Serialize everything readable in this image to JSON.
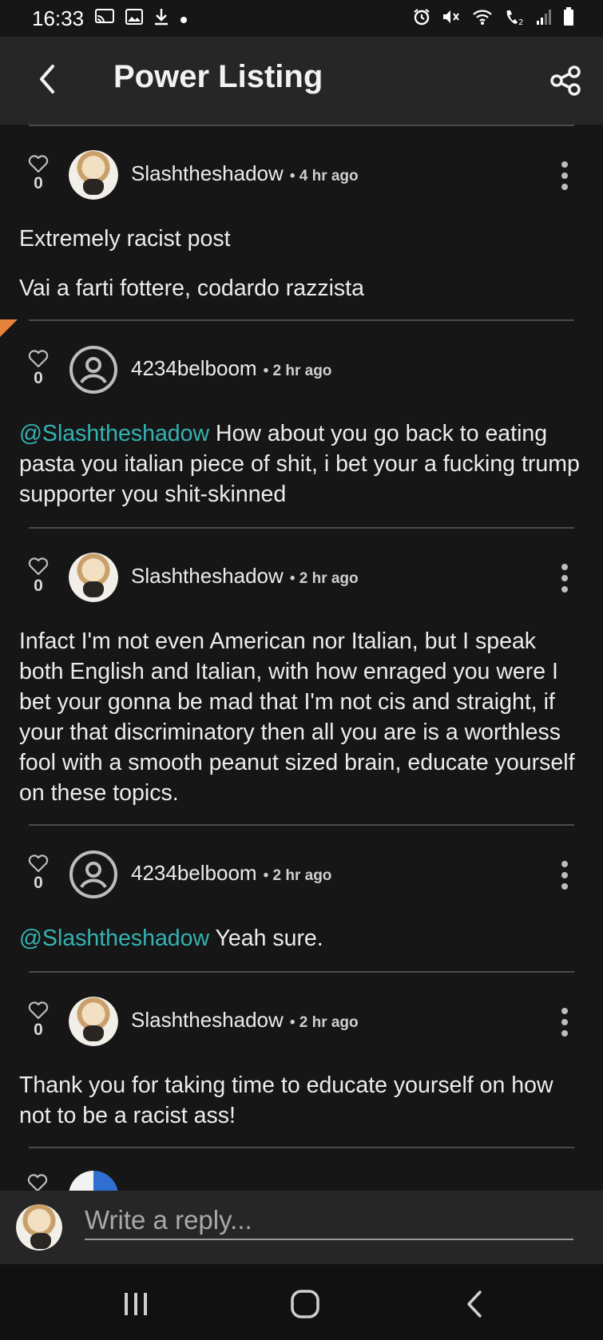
{
  "status_bar": {
    "time": "16:33",
    "left_icons": [
      "cast-icon",
      "image-icon",
      "download-icon",
      "dot-icon"
    ],
    "right_icons": [
      "alarm-icon",
      "mute-icon",
      "wifi-icon",
      "wifi-call-icon",
      "signal-icon",
      "battery-icon"
    ]
  },
  "app_bar": {
    "title": "Power Listing"
  },
  "comments": [
    {
      "likes": "0",
      "author": "Slashtheshadow",
      "time": "• 4 hr ago",
      "avatar": "user-photo",
      "paragraphs": [
        {
          "mention": "",
          "text": "Extremely racist post"
        },
        {
          "mention": "",
          "text": "Vai a farti fottere, codardo razzista"
        }
      ]
    },
    {
      "likes": "0",
      "author": "4234belboom",
      "time": "• 2 hr ago",
      "avatar": "default-user-icon",
      "paragraphs": [
        {
          "mention": "@Slashtheshadow",
          "text": " How about you go back to eating pasta you italian piece of shit, i bet your a fucking trump supporter you shit-skinned"
        }
      ]
    },
    {
      "likes": "0",
      "author": "Slashtheshadow",
      "time": "• 2 hr ago",
      "avatar": "user-photo",
      "paragraphs": [
        {
          "mention": "",
          "text": "Infact I'm not even American nor Italian, but I speak both English and Italian, with how enraged you were I bet your gonna be mad that I'm not cis and straight, if your that discriminatory then all you are is a worthless fool with a smooth peanut sized brain, educate yourself on these topics."
        }
      ]
    },
    {
      "likes": "0",
      "author": "4234belboom",
      "time": "• 2 hr ago",
      "avatar": "default-user-icon",
      "paragraphs": [
        {
          "mention": "@Slashtheshadow",
          "text": " Yeah sure."
        }
      ]
    },
    {
      "likes": "0",
      "author": "Slashtheshadow",
      "time": "• 2 hr ago",
      "avatar": "user-photo",
      "paragraphs": [
        {
          "mention": "",
          "text": "Thank you for taking time to educate yourself on how not to be a racist ass!"
        }
      ]
    }
  ],
  "reply": {
    "placeholder": "Write a reply..."
  },
  "nav_bar": {
    "buttons": [
      "recents-icon",
      "home-icon",
      "back-icon"
    ]
  },
  "colors": {
    "background": "#161616",
    "app_bar": "#262626",
    "mention": "#34b3b3",
    "marker": "#e7823a"
  }
}
